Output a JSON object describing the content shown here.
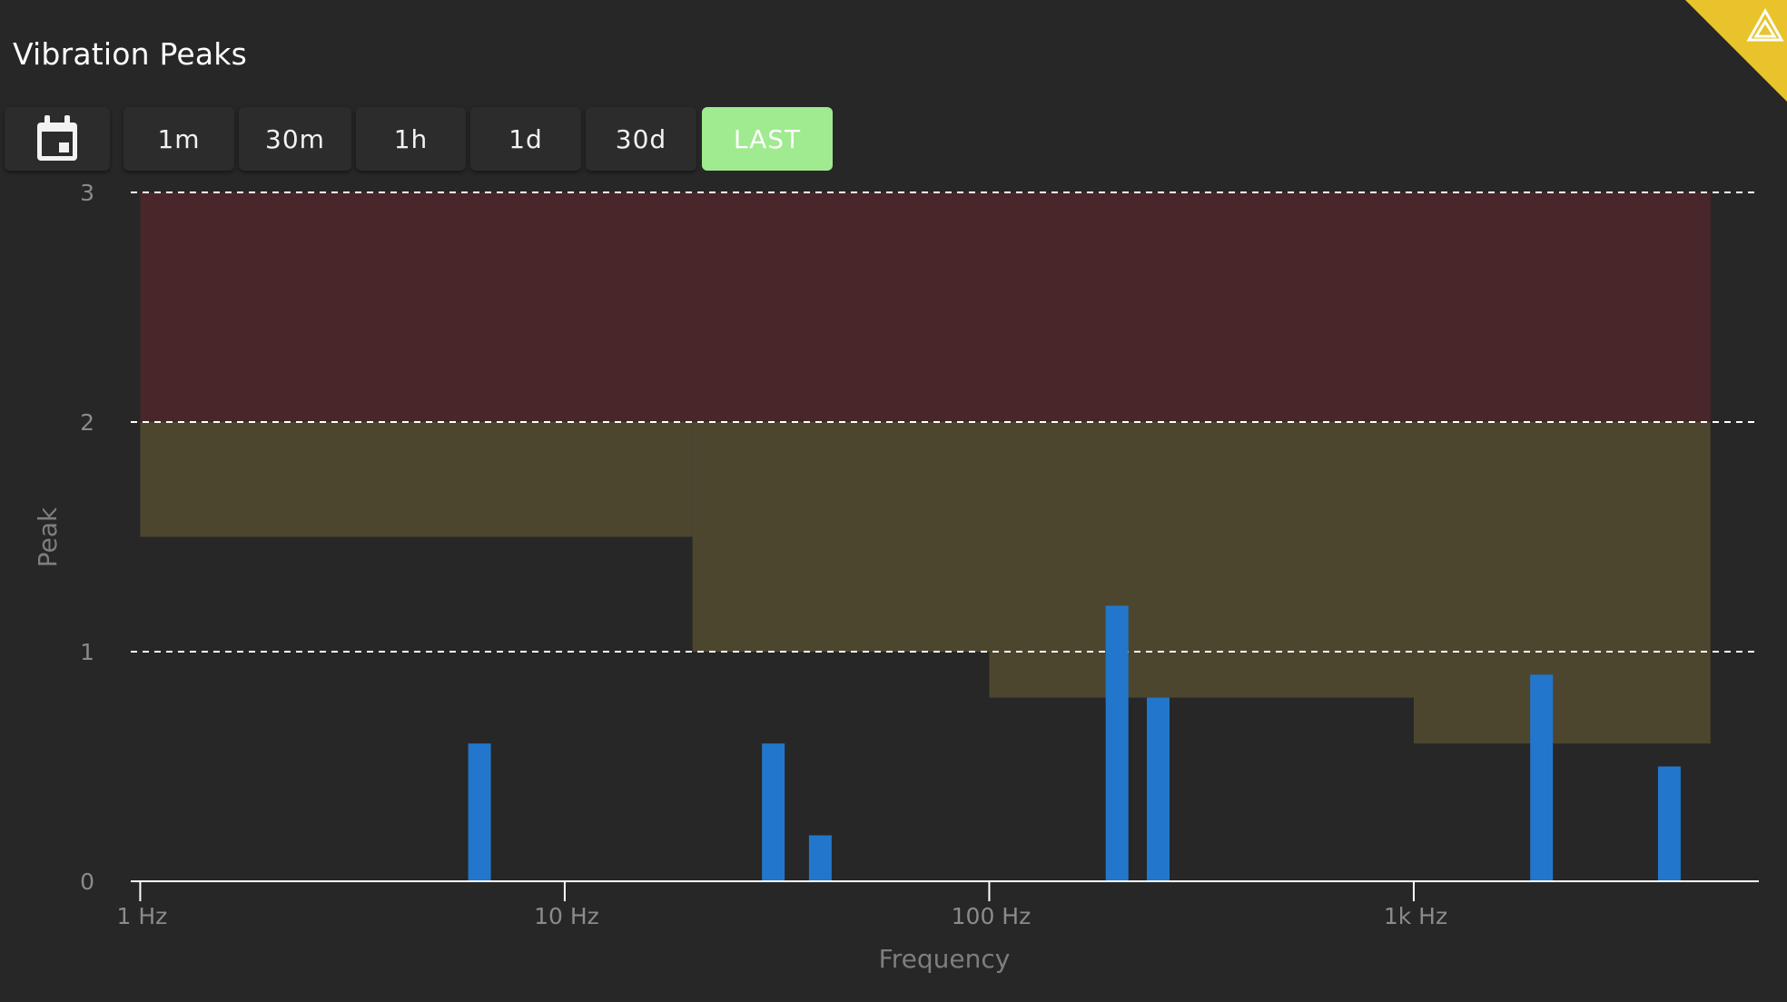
{
  "header": {
    "title": "Vibration Peaks"
  },
  "toolbar": {
    "calendar_icon": "calendar-icon",
    "ranges": [
      {
        "label": "1m",
        "active": false
      },
      {
        "label": "30m",
        "active": false
      },
      {
        "label": "1h",
        "active": false
      },
      {
        "label": "1d",
        "active": false
      },
      {
        "label": "30d",
        "active": false
      },
      {
        "label": "LAST",
        "active": true
      }
    ]
  },
  "badge": {
    "icon": "warning-triangle-icon",
    "color": "#e9c32b"
  },
  "colors": {
    "bar": "#2277cc",
    "alarm_zone": "#48262a",
    "warning_zone": "#4c462f",
    "threshold_line": "#ffffff",
    "axis_line": "#ffffff",
    "active_button": "#a0ea90"
  },
  "chart_data": {
    "type": "bar",
    "xlabel": "Frequency",
    "ylabel": "Peak",
    "x_scale": "log",
    "xlim": [
      0.95,
      6500
    ],
    "ylim": [
      0,
      3
    ],
    "x_ticks": [
      {
        "value": 1,
        "label": "1 Hz"
      },
      {
        "value": 10,
        "label": "10 Hz"
      },
      {
        "value": 100,
        "label": "100 Hz"
      },
      {
        "value": 1000,
        "label": "1k Hz"
      }
    ],
    "y_ticks": [
      0,
      1,
      2,
      3
    ],
    "grid": false,
    "threshold_lines": [
      1,
      2,
      3
    ],
    "series": [
      {
        "x": [
          6.3,
          31,
          40,
          200,
          250,
          2000,
          4000
        ],
        "values": [
          0.6,
          0.6,
          0.2,
          1.2,
          0.8,
          0.9,
          0.5
        ]
      }
    ],
    "zones": {
      "alarm": {
        "from": 2,
        "to": 3,
        "x_range": [
          1,
          5000
        ]
      },
      "warning_lower_bound": [
        {
          "x_from": 1,
          "x_to": 20,
          "y": 1.5
        },
        {
          "x_from": 20,
          "x_to": 100,
          "y": 1.0
        },
        {
          "x_from": 100,
          "x_to": 1000,
          "y": 0.8
        },
        {
          "x_from": 1000,
          "x_to": 5000,
          "y": 0.6
        }
      ],
      "warning_upper_bound": 2
    }
  }
}
